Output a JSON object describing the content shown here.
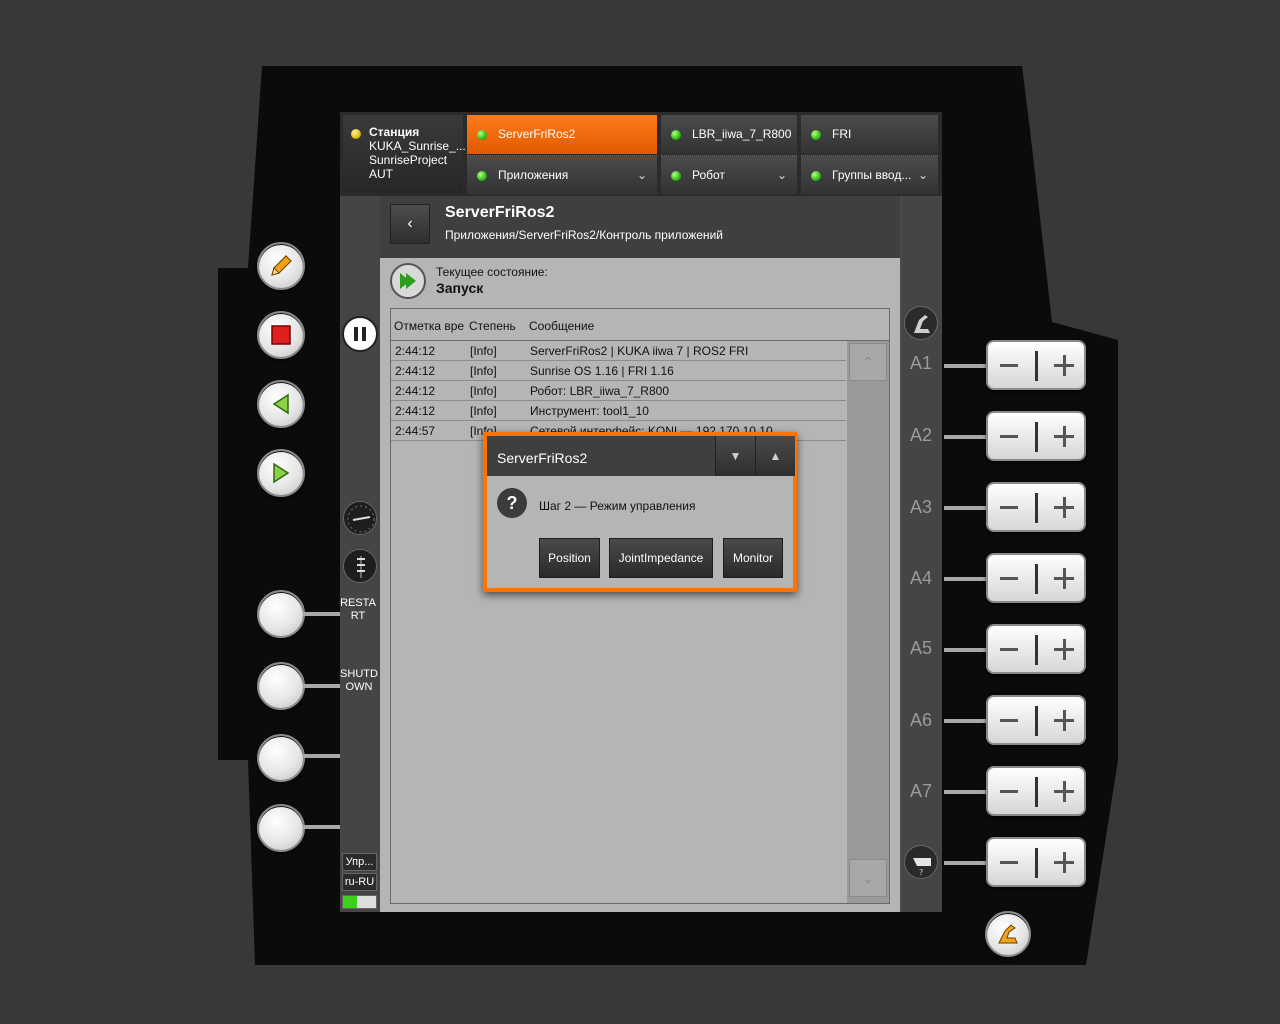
{
  "header": {
    "station": {
      "title": "Станция",
      "line1": "KUKA_Sunrise_...",
      "line2": "SunriseProject",
      "line3": "AUT"
    },
    "tabs_top": [
      {
        "label": "ServerFriRos2",
        "active": true
      },
      {
        "label": "LBR_iiwa_7_R800",
        "active": false
      },
      {
        "label": "FRI",
        "active": false
      }
    ],
    "tabs_bottom": [
      {
        "label": "Приложения"
      },
      {
        "label": "Робот"
      },
      {
        "label": "Группы ввод..."
      }
    ]
  },
  "page": {
    "title": "ServerFriRos2",
    "path": "Приложения/ServerFriRos2/Контроль приложений",
    "state_label": "Текущее состояние:",
    "state_value": "Запуск"
  },
  "log": {
    "columns": [
      "Отметка вре",
      "Степень",
      "Сообщение"
    ],
    "rows": [
      {
        "time": "2:44:12",
        "level": "[Info]",
        "message": "ServerFriRos2 | KUKA iiwa 7 | ROS2 FRI"
      },
      {
        "time": "2:44:12",
        "level": "[Info]",
        "message": "Sunrise OS 1.16 | FRI 1.16"
      },
      {
        "time": "2:44:12",
        "level": "[Info]",
        "message": "Робот: LBR_iiwa_7_R800"
      },
      {
        "time": "2:44:12",
        "level": "[Info]",
        "message": "Инструмент: tool1_10"
      },
      {
        "time": "2:44:57",
        "level": "[Info]",
        "message": "Сетевой интерфейс: KONI — 192.170.10.10"
      }
    ]
  },
  "dialog": {
    "title": "ServerFriRos2",
    "message": "Шаг 2 — Режим управления",
    "buttons": [
      "Position",
      "JointImpedance",
      "Monitor"
    ]
  },
  "side": {
    "restart": "RESTA RT",
    "shutdown": "SHUTD OWN",
    "chip1": "Упр...",
    "chip2": "ru-RU"
  },
  "axes": [
    "A1",
    "A2",
    "A3",
    "A4",
    "A5",
    "A6",
    "A7"
  ],
  "colors": {
    "accent": "#ff7300",
    "led_green": "#39c21b",
    "led_yellow": "#e5c21a"
  }
}
